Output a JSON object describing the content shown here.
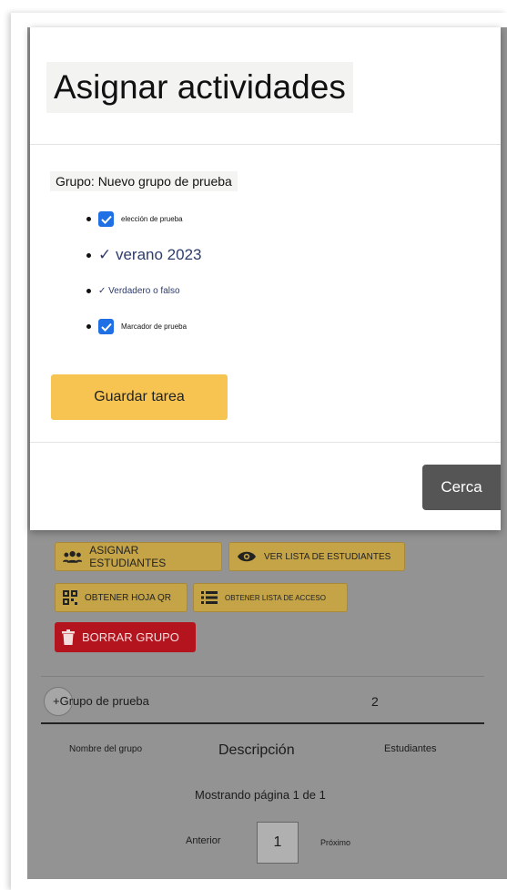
{
  "modal": {
    "title": "Asignar actividades",
    "group_label": "Grupo: Nuevo grupo de prueba",
    "activities": [
      {
        "label": "elección de prueba",
        "checked": true
      },
      {
        "label": "✓ verano 2023",
        "checked": false
      },
      {
        "label": "✓ Verdadero o falso",
        "checked": false
      },
      {
        "label": "Marcador de prueba",
        "checked": true
      }
    ],
    "save_label": "Guardar tarea",
    "close_label": "Cerca"
  },
  "actions": {
    "assign_students": "ASIGNAR ESTUDIANTES",
    "view_students": "VER LISTA DE ESTUDIANTES",
    "qr_sheet": "OBTENER HOJA QR",
    "access_list": "OBTENER LISTA DE ACCESO",
    "delete_group": "BORRAR GRUPO"
  },
  "table": {
    "row": {
      "name": "+Grupo de prueba",
      "students": "2"
    },
    "headers": [
      "Nombre del grupo",
      "Descripción",
      "Estudiantes"
    ]
  },
  "pagination": {
    "status": "Mostrando página 1 de 1",
    "prev": "Anterior",
    "page": "1",
    "next": "Próximo"
  },
  "colors": {
    "accent": "#f8c451",
    "danger": "#b3141d",
    "checkbox": "#1f6fe5"
  }
}
